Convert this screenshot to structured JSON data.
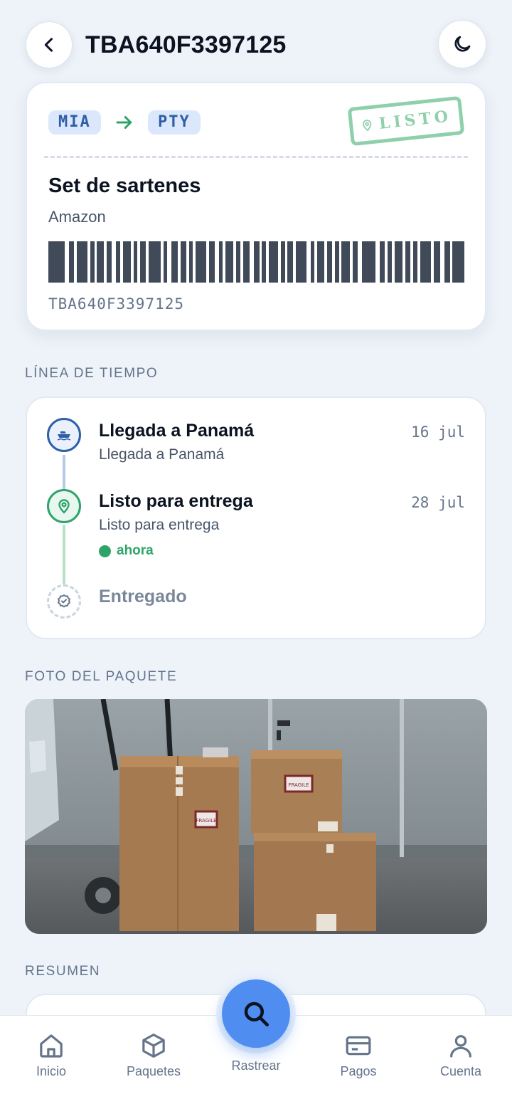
{
  "header": {
    "title": "TBA640F3397125",
    "back_icon": "chevron-left-icon",
    "theme_icon": "moon-icon"
  },
  "ticket": {
    "origin": "MIA",
    "destination": "PTY",
    "stamp_label": "LISTO",
    "item_name": "Set de sartenes",
    "store": "Amazon",
    "tracking_code": "TBA640F3397125",
    "accent_color": "#2fa46a"
  },
  "timeline": {
    "section_label": "LÍNEA DE TIEMPO",
    "events": [
      {
        "title": "Llegada a Panamá",
        "subtitle": "Llegada a Panamá",
        "date": "16 jul",
        "icon": "ship-icon",
        "status": "done"
      },
      {
        "title": "Listo para entrega",
        "subtitle": "Listo para entrega",
        "date": "28 jul",
        "icon": "map-pin-icon",
        "status": "current",
        "badge": "ahora"
      },
      {
        "title": "Entregado",
        "icon": "badge-check-icon",
        "status": "pending"
      }
    ]
  },
  "photo": {
    "section_label": "FOTO DEL PAQUETE",
    "label_fragile": "FRAGILE"
  },
  "summary": {
    "section_label": "RESUMEN"
  },
  "nav": {
    "items": [
      {
        "label": "Inicio",
        "icon": "home-icon"
      },
      {
        "label": "Paquetes",
        "icon": "package-icon"
      },
      {
        "label": "Rastrear",
        "icon": "search-icon"
      },
      {
        "label": "Pagos",
        "icon": "credit-card-icon"
      },
      {
        "label": "Cuenta",
        "icon": "user-icon"
      }
    ]
  }
}
